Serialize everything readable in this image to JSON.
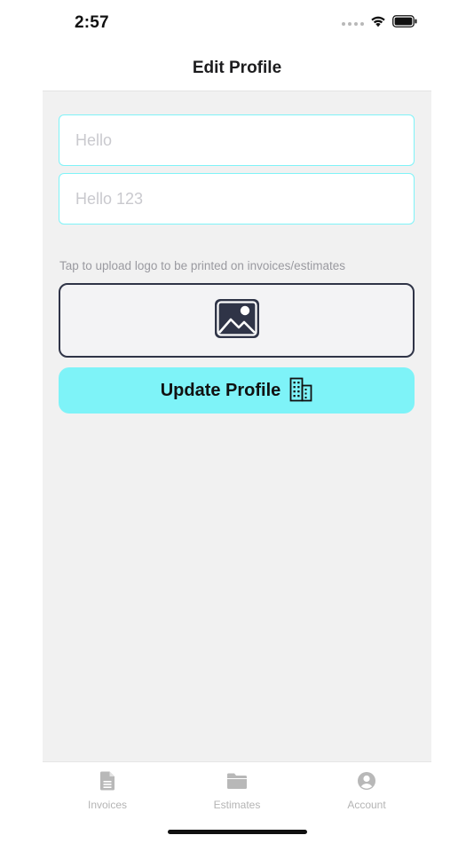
{
  "status_bar": {
    "time": "2:57",
    "icons": [
      "cellular-signal-icon",
      "wifi-icon",
      "battery-icon"
    ]
  },
  "header": {
    "title": "Edit Profile"
  },
  "form": {
    "name_field": {
      "value": "",
      "placeholder": "Hello"
    },
    "phone_field": {
      "value": "",
      "placeholder": "Hello 123"
    },
    "logo_hint": "Tap to upload logo to be printed on invoices/estimates",
    "logo_icon": "image-icon",
    "update_button": {
      "label": "Update Profile",
      "icon": "building-icon"
    }
  },
  "tab_bar": {
    "items": [
      {
        "label": "Invoices",
        "icon": "document-icon"
      },
      {
        "label": "Estimates",
        "icon": "folder-icon"
      },
      {
        "label": "Account",
        "icon": "user-circle-icon"
      }
    ]
  },
  "colors": {
    "accent": "#7EF3F8",
    "field_border": "#7FF3F8",
    "dark_border": "#2F3447",
    "content_bg": "#F1F1F1",
    "tab_inactive": "#B4B4B4"
  }
}
